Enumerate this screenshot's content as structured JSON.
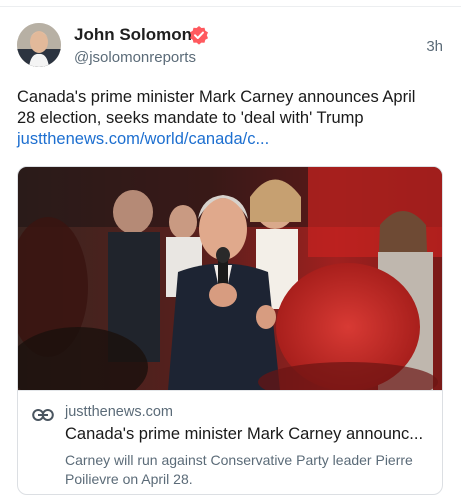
{
  "author": {
    "display_name": "John Solomon",
    "handle": "@jsolomonreports",
    "verified_color": "#ff5a5f"
  },
  "post": {
    "timestamp": "3h",
    "text_lines": [
      "Canada's prime minister Mark Carney announces April",
      "28 election, seeks mandate to 'deal with' Trump"
    ],
    "link_text": "justthenews.com/world/canada/c..."
  },
  "link_card": {
    "domain": "justthenews.com",
    "title": "Canada's prime minister Mark Carney announc...",
    "description": "Carney will run against Conservative Party leader Pierre Poilievre on April 28."
  },
  "colors": {
    "link": "#1d6fd0",
    "secondary_text": "#5b6b78"
  }
}
